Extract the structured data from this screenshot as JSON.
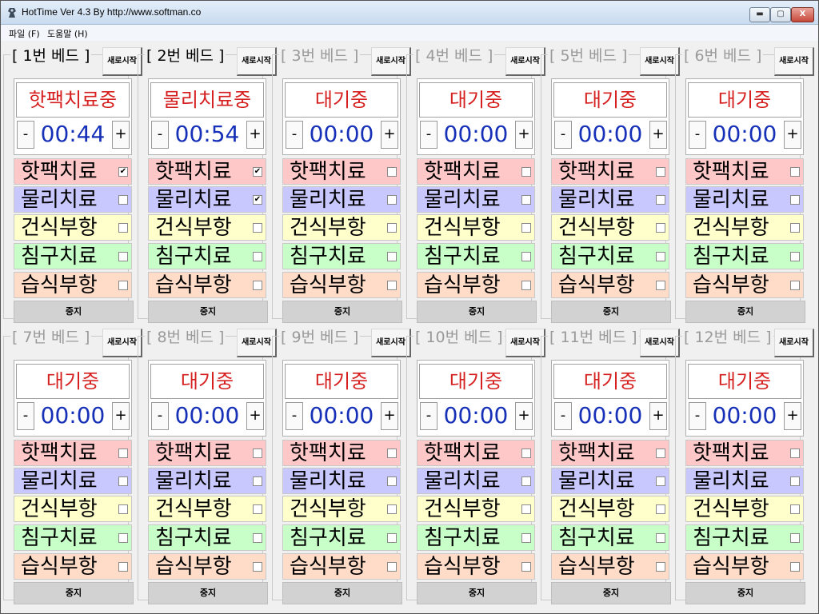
{
  "window": {
    "title": "HotTime Ver 4.3 By http://www.softman.co",
    "min_label": "▬",
    "max_label": "▢",
    "close_label": "X"
  },
  "menu": [
    {
      "label": "파일 (F)"
    },
    {
      "label": "도움말 (H)"
    }
  ],
  "beds": [
    {
      "title": "[ 1번 베드 ]",
      "active": true,
      "reset_label": "새로시작",
      "status": "핫팩치료중",
      "time": "00:44",
      "minus": "-",
      "plus": "+",
      "stop_label": "중지",
      "treatments": [
        {
          "label": "핫팩치료",
          "checked": true
        },
        {
          "label": "물리치료",
          "checked": false
        },
        {
          "label": "건식부항",
          "checked": false
        },
        {
          "label": "침구치료",
          "checked": false
        },
        {
          "label": "습식부항",
          "checked": false
        }
      ]
    },
    {
      "title": "[ 2번 베드 ]",
      "active": true,
      "reset_label": "새로시작",
      "status": "물리치료중",
      "time": "00:54",
      "minus": "-",
      "plus": "+",
      "stop_label": "중지",
      "treatments": [
        {
          "label": "핫팩치료",
          "checked": true
        },
        {
          "label": "물리치료",
          "checked": true
        },
        {
          "label": "건식부항",
          "checked": false
        },
        {
          "label": "침구치료",
          "checked": false
        },
        {
          "label": "습식부항",
          "checked": false
        }
      ]
    },
    {
      "title": "[ 3번 베드 ]",
      "active": false,
      "reset_label": "새로시작",
      "status": "대기중",
      "time": "00:00",
      "minus": "-",
      "plus": "+",
      "stop_label": "중지",
      "treatments": [
        {
          "label": "핫팩치료",
          "checked": false
        },
        {
          "label": "물리치료",
          "checked": false
        },
        {
          "label": "건식부항",
          "checked": false
        },
        {
          "label": "침구치료",
          "checked": false
        },
        {
          "label": "습식부항",
          "checked": false
        }
      ]
    },
    {
      "title": "[ 4번 베드 ]",
      "active": false,
      "reset_label": "새로시작",
      "status": "대기중",
      "time": "00:00",
      "minus": "-",
      "plus": "+",
      "stop_label": "중지",
      "treatments": [
        {
          "label": "핫팩치료",
          "checked": false
        },
        {
          "label": "물리치료",
          "checked": false
        },
        {
          "label": "건식부항",
          "checked": false
        },
        {
          "label": "침구치료",
          "checked": false
        },
        {
          "label": "습식부항",
          "checked": false
        }
      ]
    },
    {
      "title": "[ 5번 베드 ]",
      "active": false,
      "reset_label": "새로시작",
      "status": "대기중",
      "time": "00:00",
      "minus": "-",
      "plus": "+",
      "stop_label": "중지",
      "treatments": [
        {
          "label": "핫팩치료",
          "checked": false
        },
        {
          "label": "물리치료",
          "checked": false
        },
        {
          "label": "건식부항",
          "checked": false
        },
        {
          "label": "침구치료",
          "checked": false
        },
        {
          "label": "습식부항",
          "checked": false
        }
      ]
    },
    {
      "title": "[ 6번 베드 ]",
      "active": false,
      "reset_label": "새로시작",
      "status": "대기중",
      "time": "00:00",
      "minus": "-",
      "plus": "+",
      "stop_label": "중지",
      "treatments": [
        {
          "label": "핫팩치료",
          "checked": false
        },
        {
          "label": "물리치료",
          "checked": false
        },
        {
          "label": "건식부항",
          "checked": false
        },
        {
          "label": "침구치료",
          "checked": false
        },
        {
          "label": "습식부항",
          "checked": false
        }
      ]
    },
    {
      "title": "[ 7번 베드 ]",
      "active": false,
      "reset_label": "새로시작",
      "status": "대기중",
      "time": "00:00",
      "minus": "-",
      "plus": "+",
      "stop_label": "중지",
      "treatments": [
        {
          "label": "핫팩치료",
          "checked": false
        },
        {
          "label": "물리치료",
          "checked": false
        },
        {
          "label": "건식부항",
          "checked": false
        },
        {
          "label": "침구치료",
          "checked": false
        },
        {
          "label": "습식부항",
          "checked": false
        }
      ]
    },
    {
      "title": "[ 8번 베드 ]",
      "active": false,
      "reset_label": "새로시작",
      "status": "대기중",
      "time": "00:00",
      "minus": "-",
      "plus": "+",
      "stop_label": "중지",
      "treatments": [
        {
          "label": "핫팩치료",
          "checked": false
        },
        {
          "label": "물리치료",
          "checked": false
        },
        {
          "label": "건식부항",
          "checked": false
        },
        {
          "label": "침구치료",
          "checked": false
        },
        {
          "label": "습식부항",
          "checked": false
        }
      ]
    },
    {
      "title": "[ 9번 베드 ]",
      "active": false,
      "reset_label": "새로시작",
      "status": "대기중",
      "time": "00:00",
      "minus": "-",
      "plus": "+",
      "stop_label": "중지",
      "treatments": [
        {
          "label": "핫팩치료",
          "checked": false
        },
        {
          "label": "물리치료",
          "checked": false
        },
        {
          "label": "건식부항",
          "checked": false
        },
        {
          "label": "침구치료",
          "checked": false
        },
        {
          "label": "습식부항",
          "checked": false
        }
      ]
    },
    {
      "title": "[ 10번 베드 ]",
      "active": false,
      "reset_label": "새로시작",
      "status": "대기중",
      "time": "00:00",
      "minus": "-",
      "plus": "+",
      "stop_label": "중지",
      "treatments": [
        {
          "label": "핫팩치료",
          "checked": false
        },
        {
          "label": "물리치료",
          "checked": false
        },
        {
          "label": "건식부항",
          "checked": false
        },
        {
          "label": "침구치료",
          "checked": false
        },
        {
          "label": "습식부항",
          "checked": false
        }
      ]
    },
    {
      "title": "[ 11번 베드 ]",
      "active": false,
      "reset_label": "새로시작",
      "status": "대기중",
      "time": "00:00",
      "minus": "-",
      "plus": "+",
      "stop_label": "중지",
      "treatments": [
        {
          "label": "핫팩치료",
          "checked": false
        },
        {
          "label": "물리치료",
          "checked": false
        },
        {
          "label": "건식부항",
          "checked": false
        },
        {
          "label": "침구치료",
          "checked": false
        },
        {
          "label": "습식부항",
          "checked": false
        }
      ]
    },
    {
      "title": "[ 12번 베드 ]",
      "active": false,
      "reset_label": "새로시작",
      "status": "대기중",
      "time": "00:00",
      "minus": "-",
      "plus": "+",
      "stop_label": "중지",
      "treatments": [
        {
          "label": "핫팩치료",
          "checked": false
        },
        {
          "label": "물리치료",
          "checked": false
        },
        {
          "label": "건식부항",
          "checked": false
        },
        {
          "label": "침구치료",
          "checked": false
        },
        {
          "label": "습식부항",
          "checked": false
        }
      ]
    }
  ],
  "colors": {
    "status_text": "#d61f1f",
    "timer_text": "#1630b8",
    "hotpack": "#ffc8c8",
    "physio": "#c8c8ff",
    "dry_cupping": "#ffffcc",
    "acupuncture": "#c8ffc8",
    "wet_cupping": "#ffdcc8"
  }
}
